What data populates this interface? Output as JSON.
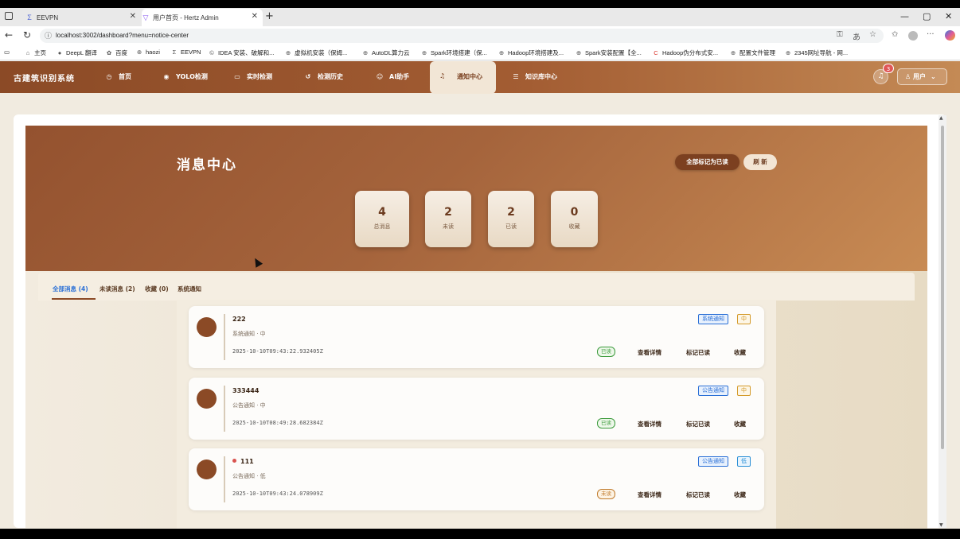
{
  "browser": {
    "tabs": [
      {
        "icon": "Σ",
        "label": "EEVPN"
      },
      {
        "icon": "▽",
        "label": "用户首页 - Hertz Admin"
      }
    ],
    "url": "localhost:3002/dashboard?menu=notice-center",
    "bookmarks": [
      {
        "icon": "⌂",
        "label": "主页"
      },
      {
        "icon": "●",
        "label": "DeepL 翻译"
      },
      {
        "icon": "✿",
        "label": "百度"
      },
      {
        "icon": "⊕",
        "label": "haozi"
      },
      {
        "icon": "Σ",
        "label": "EEVPN"
      },
      {
        "icon": "©",
        "label": "IDEA 安装、破解和..."
      },
      {
        "icon": "⊕",
        "label": "虚拟机安装（保姆..."
      },
      {
        "icon": "⊕",
        "label": "AutoDL算力云"
      },
      {
        "icon": "⊕",
        "label": "Spark环境搭建（保..."
      },
      {
        "icon": "⊕",
        "label": "Hadoop环境搭建及..."
      },
      {
        "icon": "⊕",
        "label": "Spark安装配置【全..."
      },
      {
        "icon": "C",
        "label": "Hadoop伪分布式安..."
      },
      {
        "icon": "⊕",
        "label": "配置文件管理"
      },
      {
        "icon": "⊕",
        "label": "2345网址导航 - 网..."
      }
    ]
  },
  "app": {
    "brand": "古建筑识别系统",
    "nav": [
      {
        "icon": "◷",
        "label": "首页"
      },
      {
        "icon": "◉",
        "label": "YOLO检测"
      },
      {
        "icon": "▭",
        "label": "实时检测"
      },
      {
        "icon": "↺",
        "label": "检测历史"
      },
      {
        "icon": "☺",
        "label": "AI助手"
      },
      {
        "icon": "♫",
        "label": "通知中心"
      },
      {
        "icon": "☰",
        "label": "知识库中心"
      }
    ],
    "notification_count": "3",
    "user_label": "用户"
  },
  "hero": {
    "title": "消息中心",
    "mark_all_label": "全部标记为已读",
    "refresh_label": "刷 新",
    "stats": [
      {
        "value": "4",
        "label": "总消息"
      },
      {
        "value": "2",
        "label": "未读"
      },
      {
        "value": "2",
        "label": "已读"
      },
      {
        "value": "0",
        "label": "收藏"
      }
    ]
  },
  "filters": [
    {
      "label": "全部消息 (4)"
    },
    {
      "label": "未读消息 (2)"
    },
    {
      "label": "收藏 (0)"
    },
    {
      "label": "系统通知"
    }
  ],
  "messages": [
    {
      "title": "222",
      "meta": "系统通知 · 中",
      "time": "2025-10-10T09:43:22.932405Z",
      "type_tag": "系统通知",
      "priority_tag": "中",
      "status": "已读"
    },
    {
      "title": "333444",
      "meta": "公告通知 · 中",
      "time": "2025-10-10T08:49:28.682384Z",
      "type_tag": "公告通知",
      "priority_tag": "中",
      "status": "已读"
    },
    {
      "title": "111",
      "meta": "公告通知 · 低",
      "time": "2025-10-10T09:43:24.078909Z",
      "type_tag": "公告通知",
      "priority_tag": "低",
      "status": "未读"
    }
  ],
  "actions": {
    "view": "查看详情",
    "mark": "标记已读",
    "fav": "收藏"
  }
}
